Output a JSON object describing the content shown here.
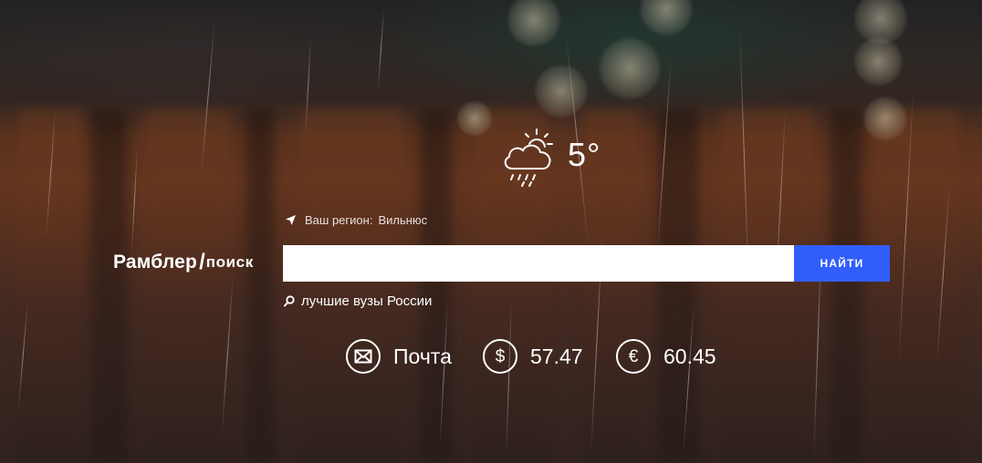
{
  "weather": {
    "temperature": "5°",
    "icon": "partly-cloudy-rain-icon"
  },
  "region": {
    "label": "Ваш регион:",
    "city": "Вильнюс",
    "icon": "location-arrow-icon"
  },
  "logo": {
    "main": "Рамблер",
    "slash": "/",
    "sub": "поиск"
  },
  "search": {
    "value": "",
    "placeholder": "",
    "button_label": "НАЙТИ",
    "button_color": "#315efb"
  },
  "suggestion": {
    "text": "лучшие вузы России",
    "icon": "search-icon"
  },
  "widgets": {
    "mail": {
      "label": "Почта",
      "icon": "envelope-icon"
    },
    "usd": {
      "symbol": "$",
      "value": "57.47",
      "icon": "dollar-icon"
    },
    "eur": {
      "symbol": "€",
      "value": "60.45",
      "icon": "euro-icon"
    }
  }
}
